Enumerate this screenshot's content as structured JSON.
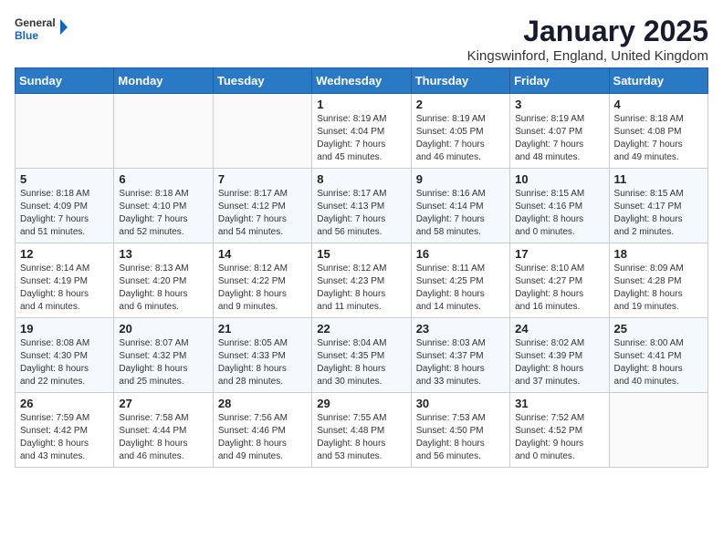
{
  "logo": {
    "text_general": "General",
    "text_blue": "Blue"
  },
  "title": "January 2025",
  "location": "Kingswinford, England, United Kingdom",
  "weekdays": [
    "Sunday",
    "Monday",
    "Tuesday",
    "Wednesday",
    "Thursday",
    "Friday",
    "Saturday"
  ],
  "weeks": [
    [
      {
        "day": "",
        "info": ""
      },
      {
        "day": "",
        "info": ""
      },
      {
        "day": "",
        "info": ""
      },
      {
        "day": "1",
        "info": "Sunrise: 8:19 AM\nSunset: 4:04 PM\nDaylight: 7 hours\nand 45 minutes."
      },
      {
        "day": "2",
        "info": "Sunrise: 8:19 AM\nSunset: 4:05 PM\nDaylight: 7 hours\nand 46 minutes."
      },
      {
        "day": "3",
        "info": "Sunrise: 8:19 AM\nSunset: 4:07 PM\nDaylight: 7 hours\nand 48 minutes."
      },
      {
        "day": "4",
        "info": "Sunrise: 8:18 AM\nSunset: 4:08 PM\nDaylight: 7 hours\nand 49 minutes."
      }
    ],
    [
      {
        "day": "5",
        "info": "Sunrise: 8:18 AM\nSunset: 4:09 PM\nDaylight: 7 hours\nand 51 minutes."
      },
      {
        "day": "6",
        "info": "Sunrise: 8:18 AM\nSunset: 4:10 PM\nDaylight: 7 hours\nand 52 minutes."
      },
      {
        "day": "7",
        "info": "Sunrise: 8:17 AM\nSunset: 4:12 PM\nDaylight: 7 hours\nand 54 minutes."
      },
      {
        "day": "8",
        "info": "Sunrise: 8:17 AM\nSunset: 4:13 PM\nDaylight: 7 hours\nand 56 minutes."
      },
      {
        "day": "9",
        "info": "Sunrise: 8:16 AM\nSunset: 4:14 PM\nDaylight: 7 hours\nand 58 minutes."
      },
      {
        "day": "10",
        "info": "Sunrise: 8:15 AM\nSunset: 4:16 PM\nDaylight: 8 hours\nand 0 minutes."
      },
      {
        "day": "11",
        "info": "Sunrise: 8:15 AM\nSunset: 4:17 PM\nDaylight: 8 hours\nand 2 minutes."
      }
    ],
    [
      {
        "day": "12",
        "info": "Sunrise: 8:14 AM\nSunset: 4:19 PM\nDaylight: 8 hours\nand 4 minutes."
      },
      {
        "day": "13",
        "info": "Sunrise: 8:13 AM\nSunset: 4:20 PM\nDaylight: 8 hours\nand 6 minutes."
      },
      {
        "day": "14",
        "info": "Sunrise: 8:12 AM\nSunset: 4:22 PM\nDaylight: 8 hours\nand 9 minutes."
      },
      {
        "day": "15",
        "info": "Sunrise: 8:12 AM\nSunset: 4:23 PM\nDaylight: 8 hours\nand 11 minutes."
      },
      {
        "day": "16",
        "info": "Sunrise: 8:11 AM\nSunset: 4:25 PM\nDaylight: 8 hours\nand 14 minutes."
      },
      {
        "day": "17",
        "info": "Sunrise: 8:10 AM\nSunset: 4:27 PM\nDaylight: 8 hours\nand 16 minutes."
      },
      {
        "day": "18",
        "info": "Sunrise: 8:09 AM\nSunset: 4:28 PM\nDaylight: 8 hours\nand 19 minutes."
      }
    ],
    [
      {
        "day": "19",
        "info": "Sunrise: 8:08 AM\nSunset: 4:30 PM\nDaylight: 8 hours\nand 22 minutes."
      },
      {
        "day": "20",
        "info": "Sunrise: 8:07 AM\nSunset: 4:32 PM\nDaylight: 8 hours\nand 25 minutes."
      },
      {
        "day": "21",
        "info": "Sunrise: 8:05 AM\nSunset: 4:33 PM\nDaylight: 8 hours\nand 28 minutes."
      },
      {
        "day": "22",
        "info": "Sunrise: 8:04 AM\nSunset: 4:35 PM\nDaylight: 8 hours\nand 30 minutes."
      },
      {
        "day": "23",
        "info": "Sunrise: 8:03 AM\nSunset: 4:37 PM\nDaylight: 8 hours\nand 33 minutes."
      },
      {
        "day": "24",
        "info": "Sunrise: 8:02 AM\nSunset: 4:39 PM\nDaylight: 8 hours\nand 37 minutes."
      },
      {
        "day": "25",
        "info": "Sunrise: 8:00 AM\nSunset: 4:41 PM\nDaylight: 8 hours\nand 40 minutes."
      }
    ],
    [
      {
        "day": "26",
        "info": "Sunrise: 7:59 AM\nSunset: 4:42 PM\nDaylight: 8 hours\nand 43 minutes."
      },
      {
        "day": "27",
        "info": "Sunrise: 7:58 AM\nSunset: 4:44 PM\nDaylight: 8 hours\nand 46 minutes."
      },
      {
        "day": "28",
        "info": "Sunrise: 7:56 AM\nSunset: 4:46 PM\nDaylight: 8 hours\nand 49 minutes."
      },
      {
        "day": "29",
        "info": "Sunrise: 7:55 AM\nSunset: 4:48 PM\nDaylight: 8 hours\nand 53 minutes."
      },
      {
        "day": "30",
        "info": "Sunrise: 7:53 AM\nSunset: 4:50 PM\nDaylight: 8 hours\nand 56 minutes."
      },
      {
        "day": "31",
        "info": "Sunrise: 7:52 AM\nSunset: 4:52 PM\nDaylight: 9 hours\nand 0 minutes."
      },
      {
        "day": "",
        "info": ""
      }
    ]
  ]
}
